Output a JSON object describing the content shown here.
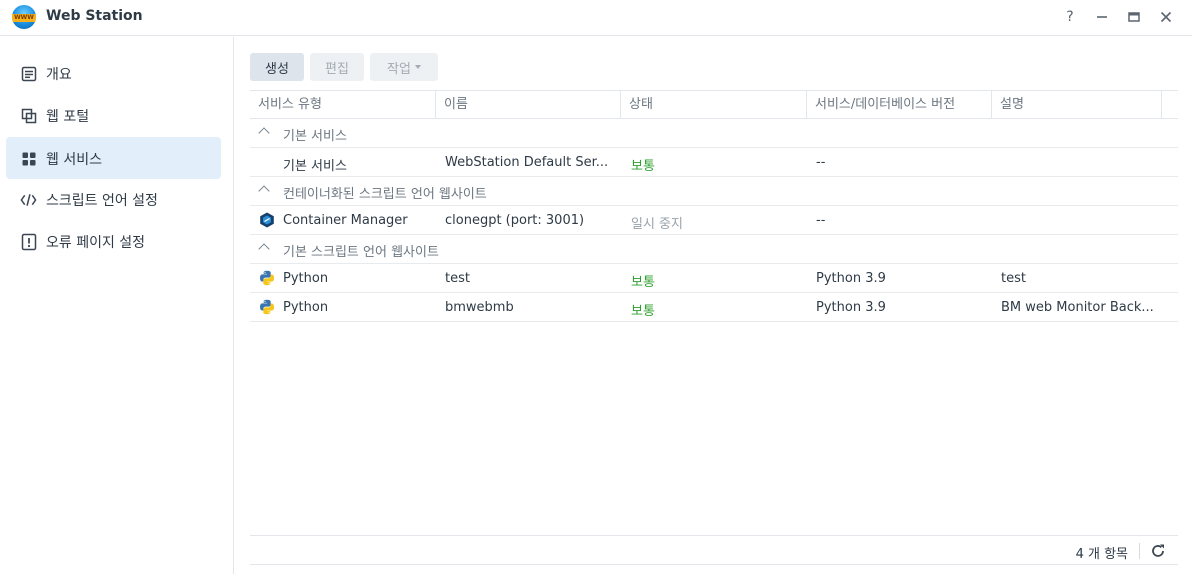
{
  "window": {
    "title": "Web Station",
    "icon_text": "WWW",
    "help_glyph": "?",
    "min_glyph": "—",
    "max_glyph": "▭",
    "close_glyph": "✕"
  },
  "sidebar": {
    "items": [
      {
        "label": "개요",
        "icon": "overview-icon",
        "active": false
      },
      {
        "label": "웹 포털",
        "icon": "web-portal-icon",
        "active": false
      },
      {
        "label": "웹 서비스",
        "icon": "grid-icon",
        "active": true
      },
      {
        "label": "스크립트 언어 설정",
        "icon": "code-icon",
        "active": false
      },
      {
        "label": "오류 페이지 설정",
        "icon": "error-page-icon",
        "active": false
      }
    ]
  },
  "toolbar": {
    "create_label": "생성",
    "edit_label": "편집",
    "action_label": "작업"
  },
  "table": {
    "columns": [
      "서비스 유형",
      "이름",
      "상태",
      "서비스/데이터베이스 버전",
      "설명"
    ],
    "groups": [
      {
        "label": "기본 서비스",
        "rows": [
          {
            "icon": "",
            "type": "기본 서비스",
            "name": "WebStation Default Ser...",
            "status": "보통",
            "status_kind": "ok",
            "version": "--",
            "description": ""
          }
        ]
      },
      {
        "label": "컨테이너화된 스크립트 언어 웹사이트",
        "rows": [
          {
            "icon": "container-manager-icon",
            "type": "Container Manager",
            "name": "clonegpt (port: 3001)",
            "status": "일시 중지",
            "status_kind": "paused",
            "version": "--",
            "description": ""
          }
        ]
      },
      {
        "label": "기본 스크립트 언어 웹사이트",
        "rows": [
          {
            "icon": "python-icon",
            "type": "Python",
            "name": "test",
            "status": "보통",
            "status_kind": "ok",
            "version": "Python 3.9",
            "description": "test"
          },
          {
            "icon": "python-icon",
            "type": "Python",
            "name": "bmwebmb",
            "status": "보통",
            "status_kind": "ok",
            "version": "Python 3.9",
            "description": "BM web Monitor Back..."
          }
        ]
      }
    ]
  },
  "footer": {
    "count_label": "4 개 항목"
  },
  "colors": {
    "accent": "#e3eefb",
    "status_ok": "#2ea02e",
    "status_paused": "#9aa3ab"
  }
}
